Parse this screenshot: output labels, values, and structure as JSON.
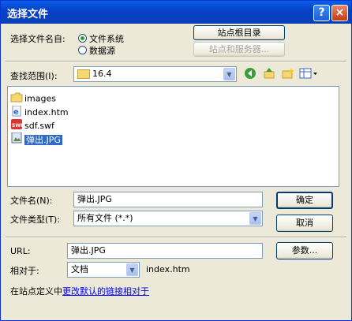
{
  "window": {
    "title": "选择文件",
    "help_label": "?",
    "close_label": "×"
  },
  "select_from": {
    "label": "选择文件名自:",
    "options": [
      {
        "label": "文件系统",
        "selected": true
      },
      {
        "label": "数据源",
        "selected": false
      }
    ]
  },
  "buttons": {
    "site_root": "站点根目录",
    "site_server": "站点和服务器...",
    "ok": "确定",
    "cancel": "取消",
    "params": "参数..."
  },
  "look_in": {
    "label": "查找范围(I):",
    "value": "16.4"
  },
  "toolbar_icons": [
    "back-icon",
    "up-folder-icon",
    "new-folder-icon",
    "view-menu-icon"
  ],
  "files": [
    {
      "name": "images",
      "icon": "folder-icon",
      "selected": false
    },
    {
      "name": "index.htm",
      "icon": "html-file-icon",
      "selected": false
    },
    {
      "name": "sdf.swf",
      "icon": "swf-file-icon",
      "selected": false
    },
    {
      "name": "弹出.JPG",
      "icon": "image-file-icon",
      "selected": true
    }
  ],
  "filename": {
    "label": "文件名(N):",
    "value": "弹出.JPG"
  },
  "filetype": {
    "label": "文件类型(T):",
    "value": "所有文件 (*.*)"
  },
  "url": {
    "label": "URL:",
    "value": "弹出.JPG"
  },
  "relative": {
    "label": "相对于:",
    "value": "文档",
    "file": "index.htm"
  },
  "footer": {
    "prefix": "在站点定义中",
    "link": "更改默认的链接相对于"
  }
}
